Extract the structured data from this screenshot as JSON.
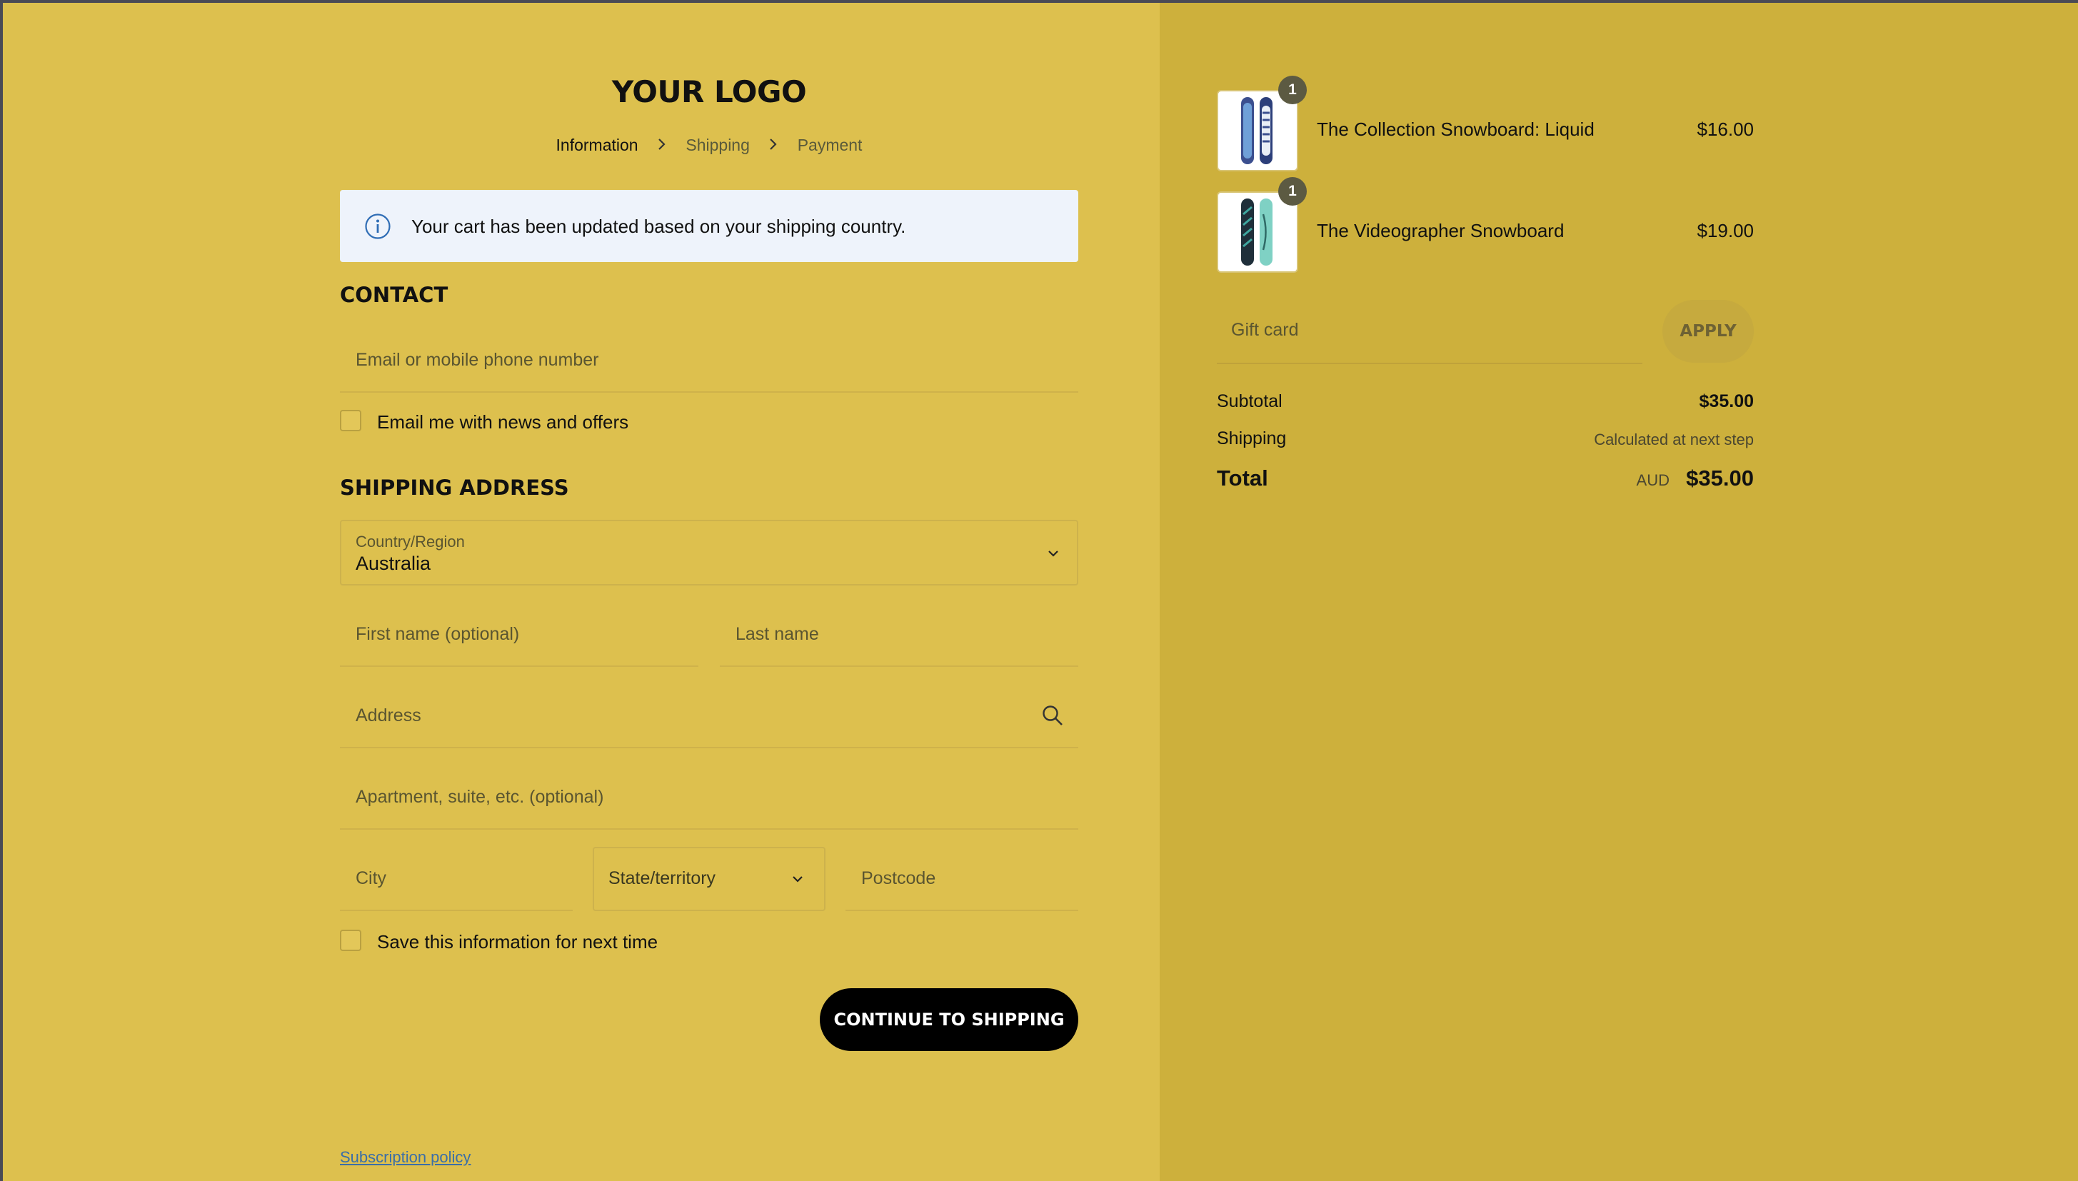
{
  "logo": "YOUR LOGO",
  "breadcrumb": {
    "items": [
      "Information",
      "Shipping",
      "Payment"
    ],
    "separator": "›"
  },
  "notice": {
    "text": "Your cart has been updated based on your shipping country.",
    "icon": "info-icon"
  },
  "contact": {
    "heading": "CONTACT",
    "email_placeholder": "Email or mobile phone number",
    "newsletter_label": "Email me with news and offers"
  },
  "shipping": {
    "heading": "SHIPPING ADDRESS",
    "country_label": "Country/Region",
    "country_value": "Australia",
    "first_name_placeholder": "First name (optional)",
    "last_name_placeholder": "Last name",
    "address_placeholder": "Address",
    "apartment_placeholder": "Apartment, suite, etc. (optional)",
    "city_placeholder": "City",
    "state_placeholder": "State/territory",
    "postcode_placeholder": "Postcode",
    "save_label": "Save this information for next time",
    "continue_label": "CONTINUE TO SHIPPING"
  },
  "footer": {
    "policy_link": "Subscription policy"
  },
  "cart": {
    "items": [
      {
        "name": "The Collection Snowboard: Liquid",
        "price": "$16.00",
        "quantity": "1"
      },
      {
        "name": "The Videographer Snowboard",
        "price": "$19.00",
        "quantity": "1"
      }
    ],
    "gift_placeholder": "Gift card",
    "apply_label": "APPLY",
    "subtotal_label": "Subtotal",
    "subtotal_value": "$35.00",
    "shipping_label": "Shipping",
    "shipping_value": "Calculated at next step",
    "total_label": "Total",
    "currency": "AUD",
    "total_value": "$35.00"
  },
  "colors": {
    "main_bg": "#ddc04e",
    "summary_bg": "#cdb03c",
    "button_bg": "#000000",
    "notice_bg": "#eef3fb",
    "link": "#3a6ea8"
  }
}
